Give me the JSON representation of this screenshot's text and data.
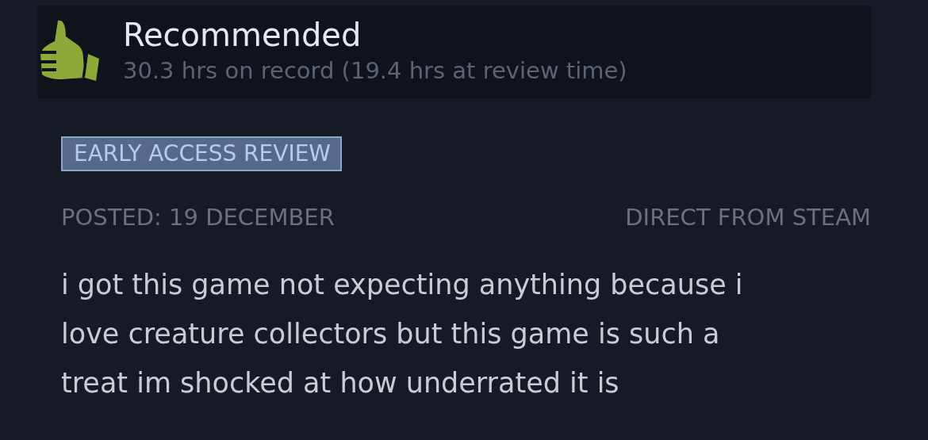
{
  "review": {
    "recommended": true,
    "verdict": "Recommended",
    "hours": "30.3 hrs on record (19.4 hrs at review time)",
    "badge": "EARLY ACCESS REVIEW",
    "posted": "POSTED: 19 DECEMBER",
    "source": "DIRECT FROM STEAM",
    "body": "i got this game not expecting anything because i love creature collectors but this game is such a treat im shocked at how underrated it is"
  }
}
